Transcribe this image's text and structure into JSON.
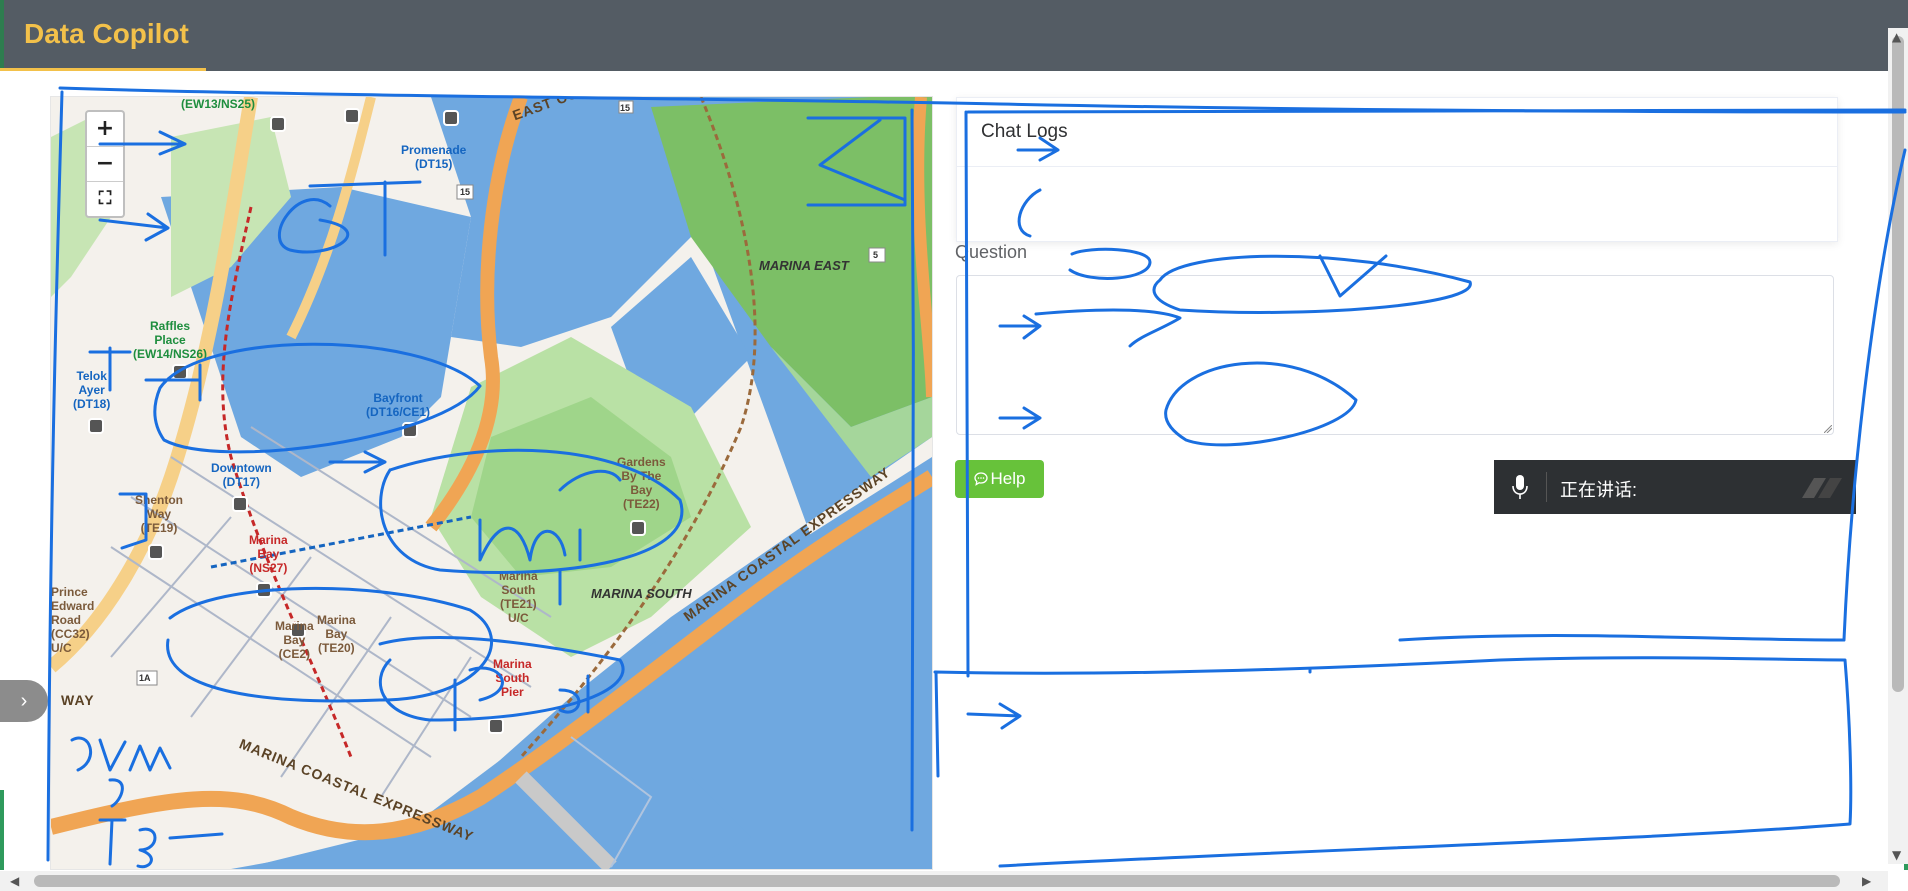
{
  "app": {
    "title": "Data Copilot"
  },
  "map": {
    "zoom_in": "+",
    "zoom_out": "−",
    "fullscreen": "⛶",
    "stations": [
      {
        "name": "(EW13/NS25)",
        "color": "green"
      },
      {
        "name": "Promenade\n(DT15)",
        "color": "blue"
      },
      {
        "name": "Raffles\nPlace\n(EW14/NS26)",
        "color": "green"
      },
      {
        "name": "Telok\nAyer\n(DT18)",
        "color": "blue"
      },
      {
        "name": "Bayfront\n(DT16/CE1)",
        "color": "blue"
      },
      {
        "name": "Downtown\n(DT17)",
        "color": "blue"
      },
      {
        "name": "Shenton\nWay\n(TE19)",
        "color": "brown"
      },
      {
        "name": "Marina\nBay\n(NS27)",
        "color": "red"
      },
      {
        "name": "Marina\nBay\n(TE20)",
        "color": "brown"
      },
      {
        "name": "Marina\nBay\n(CE2)",
        "color": "brown"
      },
      {
        "name": "Marina\nSouth\n(TE21)\nU/C",
        "color": "brown"
      },
      {
        "name": "Gardens\nBy The\nBay\n(TE22)",
        "color": "brown"
      },
      {
        "name": "Marina\nSouth\nPier",
        "color": "red"
      },
      {
        "name": "Prince\nEdward\nRoad\n(CC32)\nU/C",
        "color": "brown"
      }
    ],
    "areas": [
      "MARINA EAST",
      "MARINA SOUTH"
    ],
    "roads": [
      "MARINA COASTAL EXPRESSWAY",
      "MARINA COASTAL EXPRESSWAY",
      "EAST CO",
      "WAY"
    ],
    "road_shields": [
      "15",
      "15",
      "5",
      "1A"
    ]
  },
  "chat": {
    "title": "Chat Logs"
  },
  "question": {
    "label": "Question",
    "value": "",
    "placeholder": ""
  },
  "help_button": {
    "label": "Help"
  },
  "speech": {
    "status": "正在讲话:"
  },
  "sidebar_toggle": {
    "icon": "chevron-right-icon"
  },
  "colors": {
    "header_bg": "#545c64",
    "brand": "#f3c14a",
    "help_green": "#67c23a",
    "ink_blue": "#1a6fe0"
  }
}
